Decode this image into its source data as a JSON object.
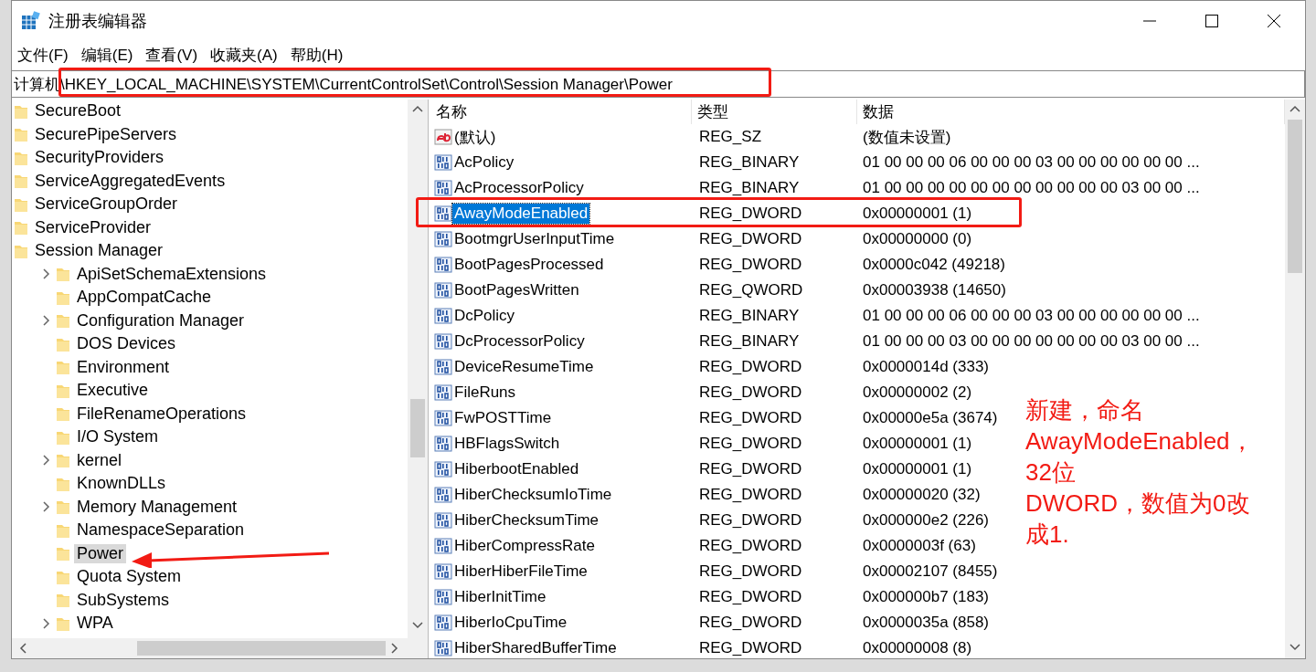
{
  "window": {
    "title": "注册表编辑器"
  },
  "menu": [
    "文件(F)",
    "编辑(E)",
    "查看(V)",
    "收藏夹(A)",
    "帮助(H)"
  ],
  "address": "计算机\\HKEY_LOCAL_MACHINE\\SYSTEM\\CurrentControlSet\\Control\\Session Manager\\Power",
  "tree": [
    {
      "label": "SecureBoot",
      "selected": false
    },
    {
      "label": "SecurePipeServers",
      "selected": false
    },
    {
      "label": "SecurityProviders",
      "selected": false
    },
    {
      "label": "ServiceAggregatedEvents",
      "selected": false
    },
    {
      "label": "ServiceGroupOrder",
      "selected": false
    },
    {
      "label": "ServiceProvider",
      "selected": false
    },
    {
      "label": "Session Manager",
      "selected": false,
      "children": [
        {
          "label": "ApiSetSchemaExtensions",
          "selected": false,
          "expandable": true
        },
        {
          "label": "AppCompatCache",
          "selected": false,
          "expandable": false
        },
        {
          "label": "Configuration Manager",
          "selected": false,
          "expandable": true
        },
        {
          "label": "DOS Devices",
          "selected": false,
          "expandable": false
        },
        {
          "label": "Environment",
          "selected": false,
          "expandable": false
        },
        {
          "label": "Executive",
          "selected": false,
          "expandable": false
        },
        {
          "label": "FileRenameOperations",
          "selected": false,
          "expandable": false
        },
        {
          "label": "I/O System",
          "selected": false,
          "expandable": false
        },
        {
          "label": "kernel",
          "selected": false,
          "expandable": true
        },
        {
          "label": "KnownDLLs",
          "selected": false,
          "expandable": false
        },
        {
          "label": "Memory Management",
          "selected": false,
          "expandable": true
        },
        {
          "label": "NamespaceSeparation",
          "selected": false,
          "expandable": false
        },
        {
          "label": "Power",
          "selected": true,
          "expandable": false
        },
        {
          "label": "Quota System",
          "selected": false,
          "expandable": false
        },
        {
          "label": "SubSystems",
          "selected": false,
          "expandable": false
        },
        {
          "label": "WPA",
          "selected": false,
          "expandable": true
        }
      ]
    }
  ],
  "table": {
    "columns": [
      "名称",
      "类型",
      "数据"
    ],
    "rows": [
      {
        "kind": "string",
        "name": "(默认)",
        "type": "REG_SZ",
        "data": "(数值未设置)",
        "selected": false
      },
      {
        "kind": "binary",
        "name": "AcPolicy",
        "type": "REG_BINARY",
        "data": "01 00 00 00 06 00 00 00 03 00 00 00 00 00 00 ...",
        "selected": false
      },
      {
        "kind": "binary",
        "name": "AcProcessorPolicy",
        "type": "REG_BINARY",
        "data": "01 00 00 00 00 00 00 00 00 00 00 00 03 00 00 ...",
        "selected": false
      },
      {
        "kind": "binary",
        "name": "AwayModeEnabled",
        "type": "REG_DWORD",
        "data": "0x00000001 (1)",
        "selected": true
      },
      {
        "kind": "binary",
        "name": "BootmgrUserInputTime",
        "type": "REG_DWORD",
        "data": "0x00000000 (0)",
        "selected": false
      },
      {
        "kind": "binary",
        "name": "BootPagesProcessed",
        "type": "REG_DWORD",
        "data": "0x0000c042 (49218)",
        "selected": false
      },
      {
        "kind": "binary",
        "name": "BootPagesWritten",
        "type": "REG_QWORD",
        "data": "0x00003938 (14650)",
        "selected": false
      },
      {
        "kind": "binary",
        "name": "DcPolicy",
        "type": "REG_BINARY",
        "data": "01 00 00 00 06 00 00 00 03 00 00 00 00 00 00 ...",
        "selected": false
      },
      {
        "kind": "binary",
        "name": "DcProcessorPolicy",
        "type": "REG_BINARY",
        "data": "01 00 00 00 03 00 00 00 00 00 00 00 03 00 00 ...",
        "selected": false
      },
      {
        "kind": "binary",
        "name": "DeviceResumeTime",
        "type": "REG_DWORD",
        "data": "0x0000014d (333)",
        "selected": false
      },
      {
        "kind": "binary",
        "name": "FileRuns",
        "type": "REG_DWORD",
        "data": "0x00000002 (2)",
        "selected": false
      },
      {
        "kind": "binary",
        "name": "FwPOSTTime",
        "type": "REG_DWORD",
        "data": "0x00000e5a (3674)",
        "selected": false
      },
      {
        "kind": "binary",
        "name": "HBFlagsSwitch",
        "type": "REG_DWORD",
        "data": "0x00000001 (1)",
        "selected": false
      },
      {
        "kind": "binary",
        "name": "HiberbootEnabled",
        "type": "REG_DWORD",
        "data": "0x00000001 (1)",
        "selected": false
      },
      {
        "kind": "binary",
        "name": "HiberChecksumIoTime",
        "type": "REG_DWORD",
        "data": "0x00000020 (32)",
        "selected": false
      },
      {
        "kind": "binary",
        "name": "HiberChecksumTime",
        "type": "REG_DWORD",
        "data": "0x000000e2 (226)",
        "selected": false
      },
      {
        "kind": "binary",
        "name": "HiberCompressRate",
        "type": "REG_DWORD",
        "data": "0x0000003f (63)",
        "selected": false
      },
      {
        "kind": "binary",
        "name": "HiberHiberFileTime",
        "type": "REG_DWORD",
        "data": "0x00002107 (8455)",
        "selected": false
      },
      {
        "kind": "binary",
        "name": "HiberInitTime",
        "type": "REG_DWORD",
        "data": "0x000000b7 (183)",
        "selected": false
      },
      {
        "kind": "binary",
        "name": "HiberIoCpuTime",
        "type": "REG_DWORD",
        "data": "0x0000035a (858)",
        "selected": false
      },
      {
        "kind": "binary",
        "name": "HiberSharedBufferTime",
        "type": "REG_DWORD",
        "data": "0x00000008 (8)",
        "selected": false
      }
    ]
  },
  "annotation": {
    "lines": [
      "新建，命名AwayModeEnabled，32位",
      "DWORD，数值为0改成1."
    ]
  }
}
